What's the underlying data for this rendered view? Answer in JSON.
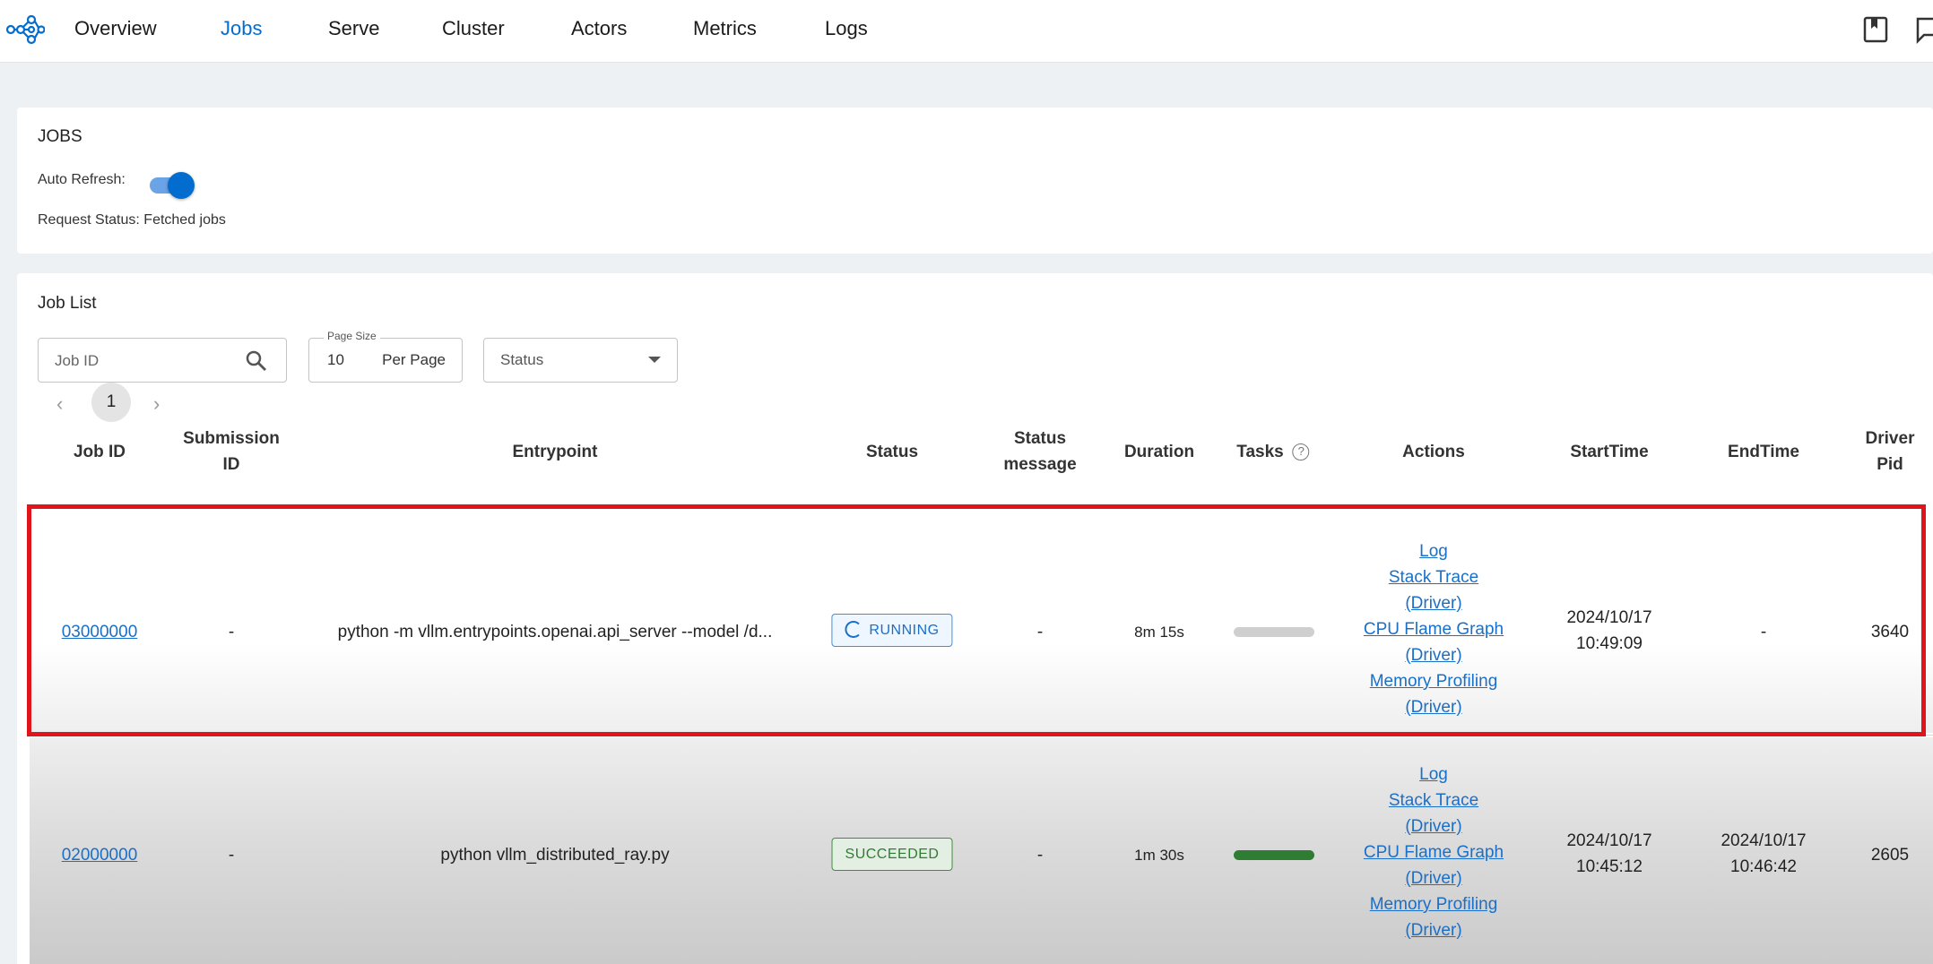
{
  "nav": {
    "items": [
      "Overview",
      "Jobs",
      "Serve",
      "Cluster",
      "Actors",
      "Metrics",
      "Logs"
    ],
    "active": "Jobs",
    "icons": [
      "ray-logo-icon",
      "docs-book-icon",
      "feedback-icon"
    ],
    "accent_color": "#036dcf"
  },
  "jobs_card": {
    "title": "JOBS",
    "auto_refresh_label": "Auto Refresh:",
    "auto_refresh_on": true,
    "request_status": "Request Status: Fetched jobs"
  },
  "job_list": {
    "title": "Job List",
    "search_placeholder": "Job ID",
    "page_size_label": "Page Size",
    "page_size_value": "10",
    "per_page_label": "Per Page",
    "status_placeholder": "Status",
    "current_page": "1",
    "pager_prev": "‹",
    "pager_next": "›",
    "columns": [
      "Job ID",
      "Submission ID",
      "Entrypoint",
      "Status",
      "Status message",
      "Duration",
      "Tasks",
      "Actions",
      "StartTime",
      "EndTime",
      "Driver Pid"
    ],
    "column_lines": {
      "submission_id": [
        "Submission",
        "ID"
      ],
      "status_message": [
        "Status",
        "message"
      ],
      "driver_pid": [
        "Driver",
        "Pid"
      ]
    },
    "help_icon_text": "?",
    "rows": [
      {
        "job_id": "03000000",
        "submission_id": "-",
        "entrypoint": "python -m vllm.entrypoints.openai.api_server --model /d...",
        "status": "RUNNING",
        "status_message": "-",
        "duration": "8m 15s",
        "tasks_progress": 0,
        "actions": [
          "Log",
          "Stack Trace",
          "(Driver)",
          "CPU Flame Graph",
          "(Driver)",
          "Memory Profiling",
          "(Driver)"
        ],
        "start_date": "2024/10/17",
        "start_time": "10:49:09",
        "end_date": "-",
        "end_time": "",
        "driver_pid": "3640"
      },
      {
        "job_id": "02000000",
        "submission_id": "-",
        "entrypoint": "python vllm_distributed_ray.py",
        "status": "SUCCEEDED",
        "status_message": "-",
        "duration": "1m 30s",
        "tasks_progress": 1,
        "actions": [
          "Log",
          "Stack Trace",
          "(Driver)",
          "CPU Flame Graph",
          "(Driver)",
          "Memory Profiling",
          "(Driver)"
        ],
        "start_date": "2024/10/17",
        "start_time": "10:45:12",
        "end_date": "2024/10/17",
        "end_time": "10:46:42",
        "driver_pid": "2605"
      }
    ]
  },
  "colors": {
    "running": "#1a6fc9",
    "succeeded": "#2e7d32",
    "highlight": "#e0141b"
  }
}
